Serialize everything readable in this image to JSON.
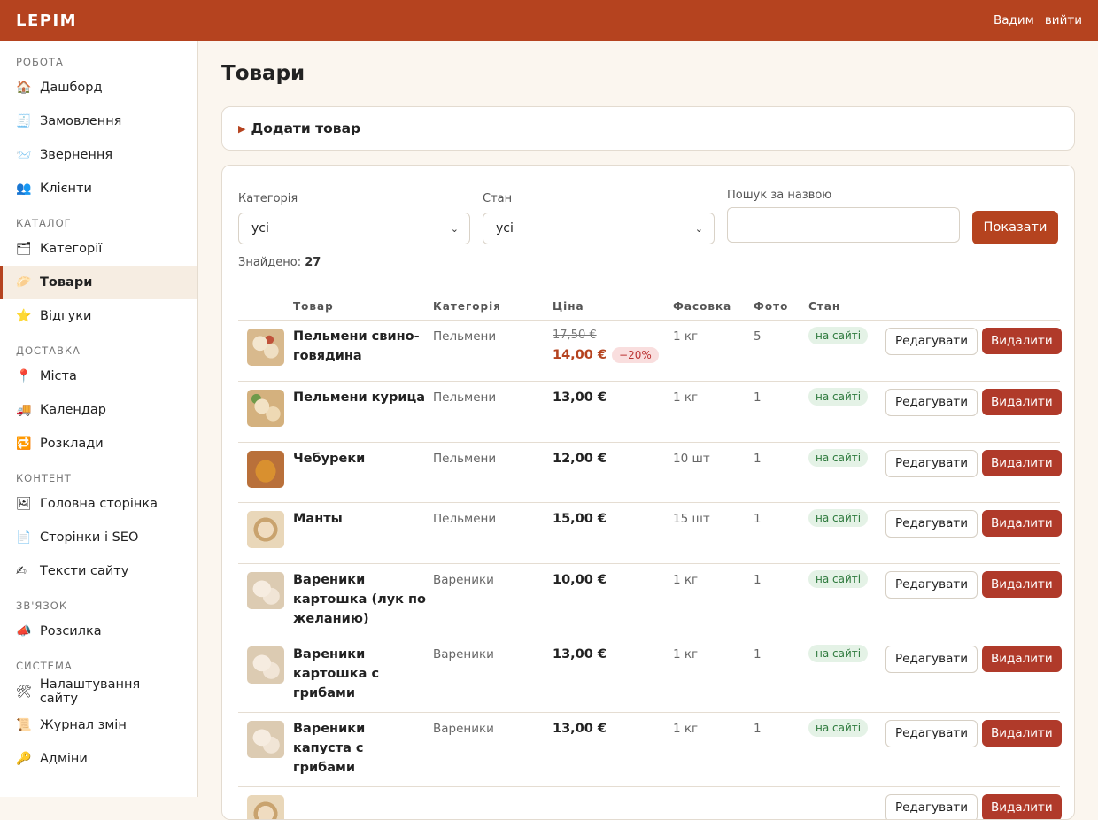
{
  "header": {
    "logo": "LEPIM",
    "user": "Вадим",
    "logout": "вийти"
  },
  "sidebar": [
    {
      "title": "Робота",
      "items": [
        {
          "icon": "🏠",
          "label": "Дашборд"
        },
        {
          "icon": "🧾",
          "label": "Замовлення"
        },
        {
          "icon": "📨",
          "label": "Звернення"
        },
        {
          "icon": "👥",
          "label": "Клієнти"
        }
      ]
    },
    {
      "title": "Каталог",
      "items": [
        {
          "icon": "🗂",
          "label": "Категорії"
        },
        {
          "icon": "🥟",
          "label": "Товари",
          "active": true
        },
        {
          "icon": "⭐",
          "label": "Відгуки"
        }
      ]
    },
    {
      "title": "Доставка",
      "items": [
        {
          "icon": "📍",
          "label": "Міста"
        },
        {
          "icon": "🚚",
          "label": "Календар"
        },
        {
          "icon": "🔁",
          "label": "Розклади"
        }
      ]
    },
    {
      "title": "Контент",
      "items": [
        {
          "icon": "🖼",
          "label": "Головна сторінка"
        },
        {
          "icon": "📄",
          "label": "Сторінки і SEO"
        },
        {
          "icon": "✍",
          "label": "Тексти сайту"
        }
      ]
    },
    {
      "title": "Зв'язок",
      "items": [
        {
          "icon": "📣",
          "label": "Розсилка"
        }
      ]
    },
    {
      "title": "Система",
      "items": [
        {
          "icon": "🛠",
          "label": "Налаштування сайту"
        },
        {
          "icon": "📜",
          "label": "Журнал змін"
        },
        {
          "icon": "🔑",
          "label": "Адміни"
        }
      ]
    }
  ],
  "page": {
    "title": "Товари",
    "add_product": "Додати товар"
  },
  "filters": {
    "category_label": "Категорія",
    "category_value": "усі",
    "state_label": "Стан",
    "state_value": "усі",
    "search_label": "Пошук за назвою",
    "search_value": "",
    "search_placeholder": "",
    "show_button": "Показати"
  },
  "found": {
    "label": "Знайдено:",
    "count": "27"
  },
  "table": {
    "headers": [
      "Товар",
      "Категорія",
      "Ціна",
      "Фасовка",
      "Фото",
      "Стан"
    ],
    "edit_label": "Редагувати",
    "delete_label": "Видалити",
    "rows": [
      {
        "name": "Пельмени свино-говядина",
        "category": "Пельмени",
        "old_price": "17,50 €",
        "price": "14,00 €",
        "discount": "−20%",
        "pack": "1 кг",
        "photos": "5",
        "state": "на сайті",
        "thumb": "t1"
      },
      {
        "name": "Пельмени курица",
        "category": "Пельмени",
        "price": "13,00 €",
        "pack": "1 кг",
        "photos": "1",
        "state": "на сайті",
        "thumb": "t2"
      },
      {
        "name": "Чебуреки",
        "category": "Пельмени",
        "price": "12,00 €",
        "pack": "10 шт",
        "photos": "1",
        "state": "на сайті",
        "thumb": "t3"
      },
      {
        "name": "Манты",
        "category": "Пельмени",
        "price": "15,00 €",
        "pack": "15 шт",
        "photos": "1",
        "state": "на сайті",
        "thumb": "t4"
      },
      {
        "name": "Вареники картошка (лук по желанию)",
        "category": "Вареники",
        "price": "10,00 €",
        "pack": "1 кг",
        "photos": "1",
        "state": "на сайті",
        "thumb": "t5"
      },
      {
        "name": "Вареники картошка с грибами",
        "category": "Вареники",
        "price": "13,00 €",
        "pack": "1 кг",
        "photos": "1",
        "state": "на сайті",
        "thumb": "t5"
      },
      {
        "name": "Вареники капуста с грибами",
        "category": "Вареники",
        "price": "13,00 €",
        "pack": "1 кг",
        "photos": "1",
        "state": "на сайті",
        "thumb": "t5"
      },
      {
        "name": "",
        "category": "",
        "price": "",
        "pack": "",
        "photos": "",
        "state": "",
        "thumb": "t4"
      }
    ]
  }
}
